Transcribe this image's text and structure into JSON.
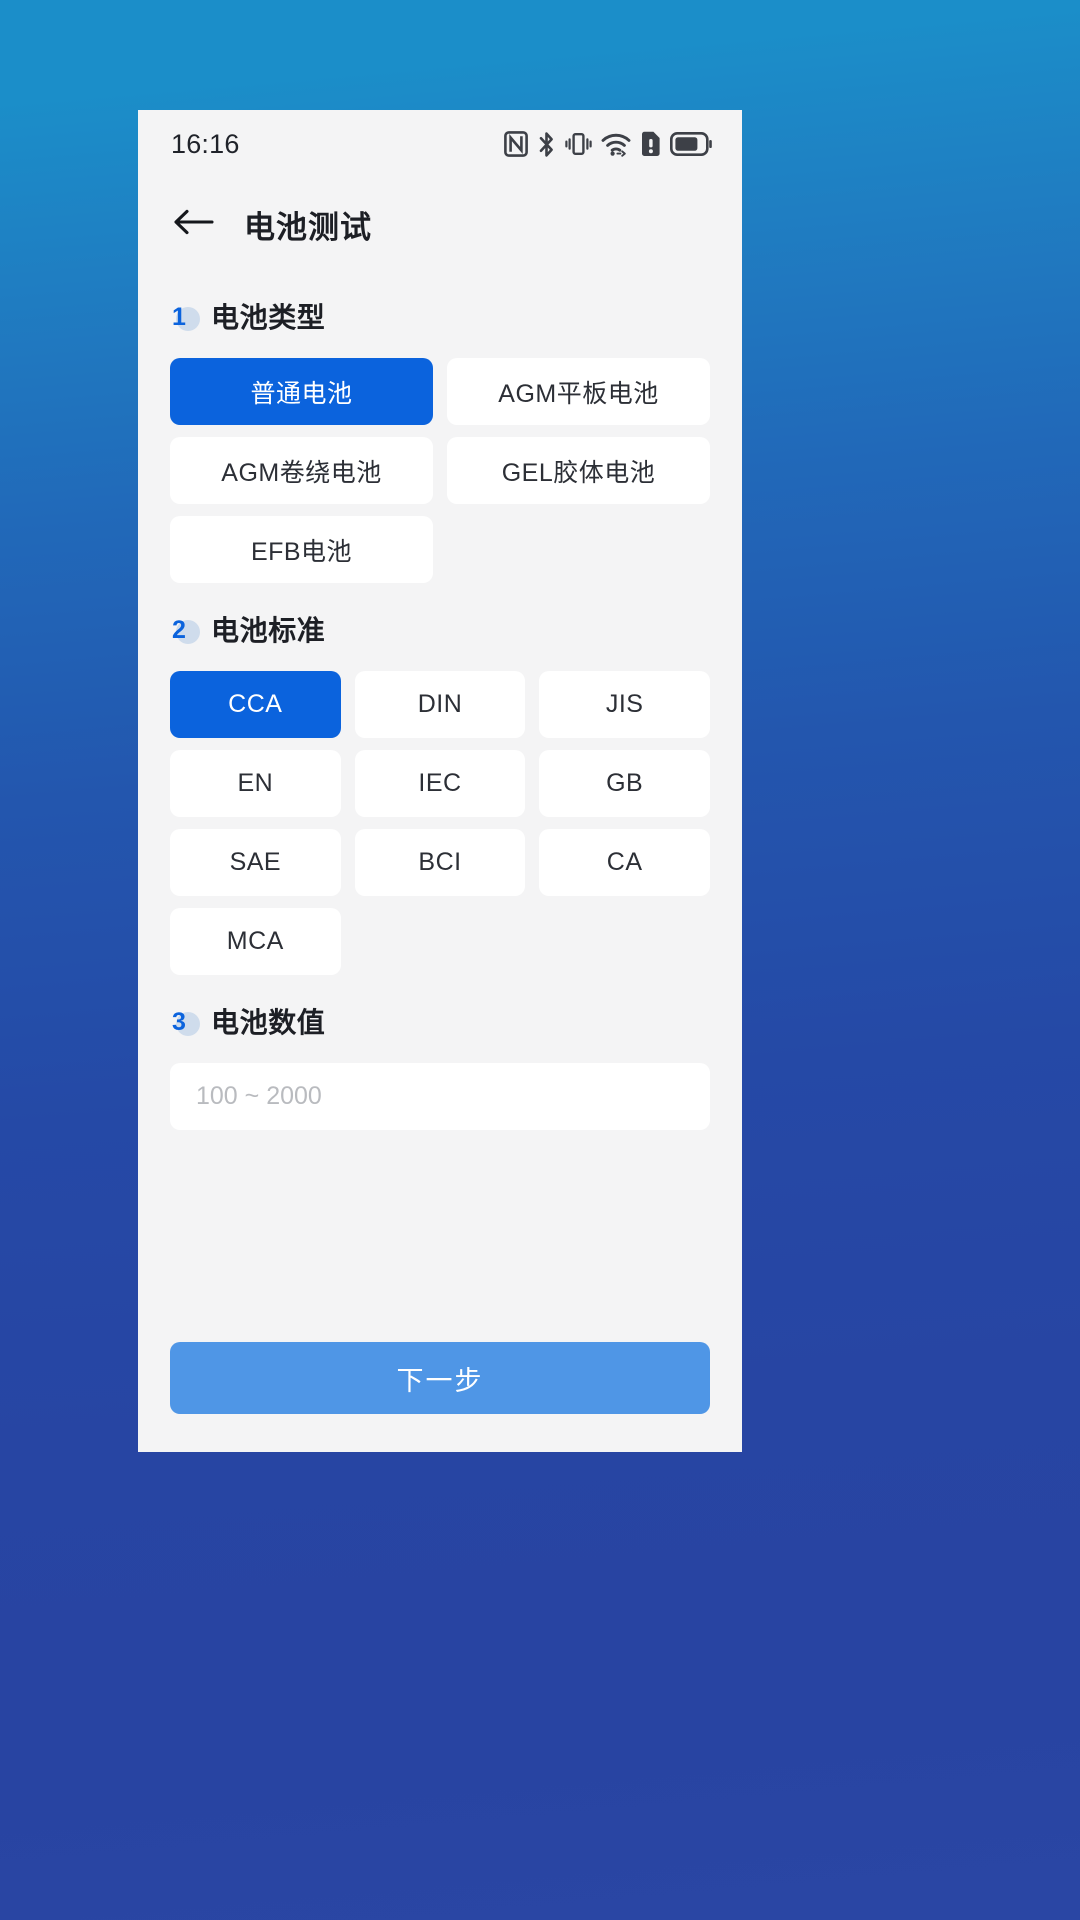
{
  "theme": {
    "accent": "#0b63dd",
    "panel_bg": "#f4f4f5",
    "card_bg": "#ffffff",
    "primary_button_bg": "#4f96e6",
    "wallpaper_top": "#1b8ec9",
    "wallpaper_bottom": "#2a46a4"
  },
  "status_bar": {
    "time": "16:16",
    "icons": [
      "nfc-icon",
      "bluetooth-icon",
      "vibrate-icon",
      "wifi-icon",
      "sim-alert-icon",
      "battery-icon"
    ]
  },
  "app_bar": {
    "back_icon": "back-arrow-icon",
    "title": "电池测试"
  },
  "sections": [
    {
      "step": "1",
      "title": "电池类型",
      "columns": 2,
      "options": [
        {
          "label": "普通电池",
          "selected": true
        },
        {
          "label": "AGM平板电池",
          "selected": false
        },
        {
          "label": "AGM卷绕电池",
          "selected": false
        },
        {
          "label": "GEL胶体电池",
          "selected": false
        },
        {
          "label": "EFB电池",
          "selected": false
        }
      ]
    },
    {
      "step": "2",
      "title": "电池标准",
      "columns": 3,
      "options": [
        {
          "label": "CCA",
          "selected": true
        },
        {
          "label": "DIN",
          "selected": false
        },
        {
          "label": "JIS",
          "selected": false
        },
        {
          "label": "EN",
          "selected": false
        },
        {
          "label": "IEC",
          "selected": false
        },
        {
          "label": "GB",
          "selected": false
        },
        {
          "label": "SAE",
          "selected": false
        },
        {
          "label": "BCI",
          "selected": false
        },
        {
          "label": "CA",
          "selected": false
        },
        {
          "label": "MCA",
          "selected": false
        }
      ]
    },
    {
      "step": "3",
      "title": "电池数值",
      "input": {
        "value": "",
        "placeholder": "100 ~ 2000"
      }
    }
  ],
  "footer": {
    "next_label": "下一步"
  }
}
